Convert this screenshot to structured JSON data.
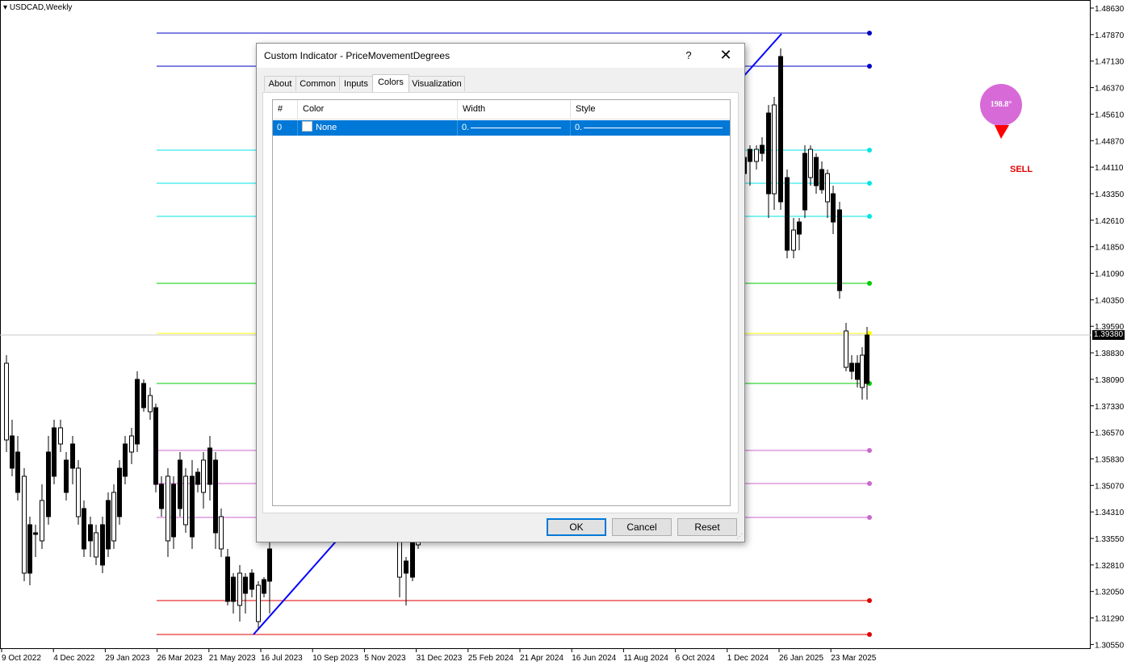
{
  "chart": {
    "symbol_title": "USDCAD,Weekly",
    "current_price": "1.39380",
    "price_axis": [
      "1.48630",
      "1.47870",
      "1.47130",
      "1.46370",
      "1.45610",
      "1.44870",
      "1.44110",
      "1.43350",
      "1.42610",
      "1.41850",
      "1.41090",
      "1.40350",
      "1.39590",
      "1.38830",
      "1.38090",
      "1.37330",
      "1.36570",
      "1.35830",
      "1.35070",
      "1.34310",
      "1.33550",
      "1.32810",
      "1.32050",
      "1.31290",
      "1.30550"
    ],
    "time_axis": [
      "9 Oct 2022",
      "4 Dec 2022",
      "29 Jan 2023",
      "26 Mar 2023",
      "21 May 2023",
      "16 Jul 2023",
      "10 Sep 2023",
      "5 Nov 2023",
      "31 Dec 2023",
      "25 Feb 2024",
      "21 Apr 2024",
      "16 Jun 2024",
      "11 Aug 2024",
      "6 Oct 2024",
      "1 Dec 2024",
      "26 Jan 2025",
      "23 Mar 2025"
    ],
    "angle_badge": "198.8°",
    "signal": "SELL",
    "colors": {
      "level_blue": "#0000c8",
      "level_cyan": "#00e5e5",
      "level_green": "#00cc00",
      "level_yellow": "#ffff00",
      "level_violet": "#cc66cc",
      "level_red": "#e00000",
      "trend_line": "#0000ff",
      "badge": "#d86ad8"
    }
  },
  "dialog": {
    "title": "Custom Indicator - PriceMovementDegrees",
    "help_label": "?",
    "close_label": "✕",
    "tabs": [
      {
        "label": "About",
        "active": false
      },
      {
        "label": "Common",
        "active": false
      },
      {
        "label": "Inputs",
        "active": false
      },
      {
        "label": "Colors",
        "active": true
      },
      {
        "label": "Visualization",
        "active": false
      }
    ],
    "grid": {
      "headers": [
        "#",
        "Color",
        "Width",
        "Style"
      ],
      "rows": [
        {
          "index": "0",
          "color": "None",
          "width": "0.",
          "style": "0."
        }
      ]
    },
    "buttons": {
      "ok": "OK",
      "cancel": "Cancel",
      "reset": "Reset"
    }
  }
}
